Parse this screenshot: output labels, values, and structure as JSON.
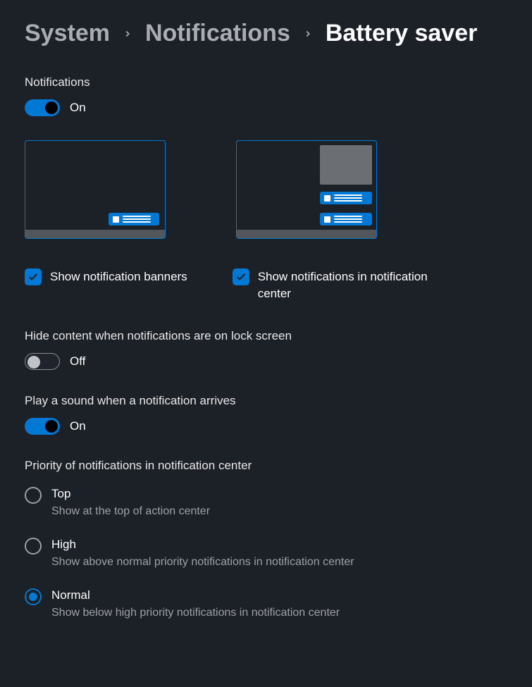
{
  "breadcrumb": {
    "items": [
      "System",
      "Notifications"
    ],
    "current": "Battery saver"
  },
  "notifications_toggle": {
    "label": "Notifications",
    "state": "On",
    "on": true
  },
  "checkboxes": {
    "banners": {
      "label": "Show notification banners",
      "checked": true
    },
    "center": {
      "label": "Show notifications in notification center",
      "checked": true
    }
  },
  "hide_content_toggle": {
    "label": "Hide content when notifications are on lock screen",
    "state": "Off",
    "on": false
  },
  "sound_toggle": {
    "label": "Play a sound when a notification arrives",
    "state": "On",
    "on": true
  },
  "priority": {
    "label": "Priority of notifications in notification center",
    "options": [
      {
        "title": "Top",
        "desc": "Show at the top of action center",
        "selected": false
      },
      {
        "title": "High",
        "desc": "Show above normal priority notifications in notification center",
        "selected": false
      },
      {
        "title": "Normal",
        "desc": "Show below high priority notifications in notification center",
        "selected": true
      }
    ]
  },
  "colors": {
    "accent": "#0078d4",
    "background": "#1c2027",
    "muted_text": "#9da1a6"
  }
}
